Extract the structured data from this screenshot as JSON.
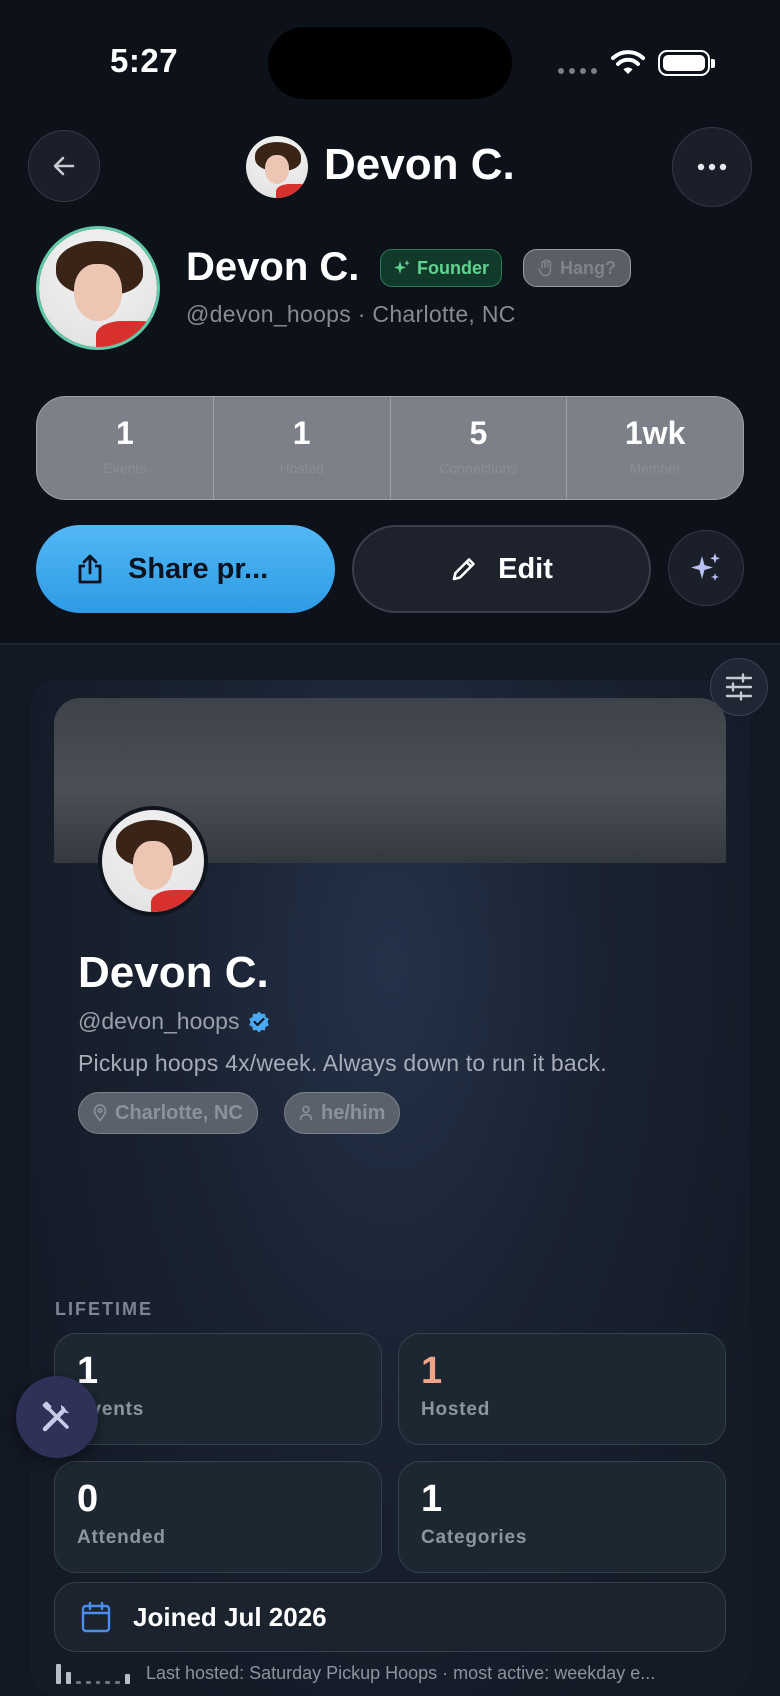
{
  "status_bar": {
    "time": "5:27"
  },
  "header": {
    "title": "Devon C."
  },
  "profile": {
    "name": "Devon C.",
    "badge_founder": "Founder",
    "badge_hang": "Hang?",
    "subtitle": "@devon_hoops · Charlotte, NC"
  },
  "stats": [
    {
      "value": "1",
      "label": "Events"
    },
    {
      "value": "1",
      "label": "Hosted"
    },
    {
      "value": "5",
      "label": "Connections"
    },
    {
      "value": "1wk",
      "label": "Member"
    }
  ],
  "actions": {
    "share_label": "Share pr...",
    "edit_label": "Edit"
  },
  "card": {
    "name": "Devon C.",
    "handle": "@devon_hoops",
    "bio": "Pickup hoops 4x/week. Always down to run it back.",
    "location": "Charlotte, NC",
    "pronouns": "he/him"
  },
  "lifetime": {
    "label": "LIFETIME",
    "tiles": [
      {
        "value": "1",
        "label": "Events"
      },
      {
        "value": "1",
        "label": "Hosted"
      },
      {
        "value": "0",
        "label": "Attended"
      },
      {
        "value": "1",
        "label": "Categories"
      }
    ]
  },
  "joined": "Joined Jul 2026",
  "footer_text": "Last hosted: Saturday Pickup Hoops · most active: weekday e...",
  "colors": {
    "accent": "#2e9be6",
    "founder": "#5fd38f",
    "hosted": "#f0a488",
    "verified": "#4aa9f0"
  }
}
